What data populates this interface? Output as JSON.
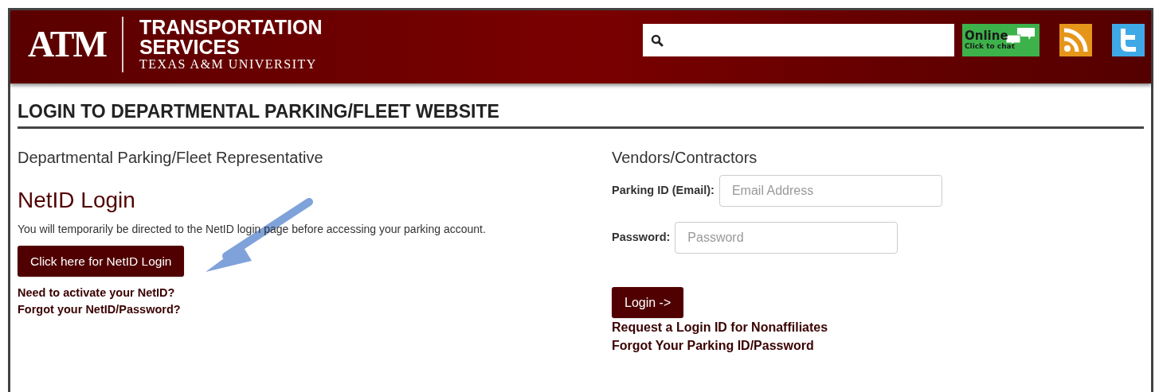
{
  "header": {
    "logo_mark": "ATM",
    "title_line1": "TRANSPORTATION",
    "title_line2": "SERVICES",
    "subtitle": "TEXAS A&M UNIVERSITY",
    "search": {
      "kind": "icon-only"
    },
    "chat": {
      "status": "Online",
      "action": "Click to chat"
    }
  },
  "page_title": "LOGIN TO DEPARTMENTAL PARKING/FLEET WEBSITE",
  "left": {
    "heading": "Departmental Parking/Fleet Representative",
    "subheading": "NetID Login",
    "note": "You will temporarily be directed to the NetID login page before accessing your parking account.",
    "button": "Click here for NetID Login",
    "links": [
      "Need to activate your NetID?",
      "Forgot your NetID/Password?"
    ]
  },
  "right": {
    "heading": "Vendors/Contractors",
    "fields": [
      {
        "label": "Parking ID (Email):",
        "placeholder": "Email Address"
      },
      {
        "label": "Password:",
        "placeholder": "Password"
      }
    ],
    "button": "Login ->",
    "links": [
      "Request a Login ID for Nonaffiliates",
      "Forgot Your Parking ID/Password"
    ]
  }
}
